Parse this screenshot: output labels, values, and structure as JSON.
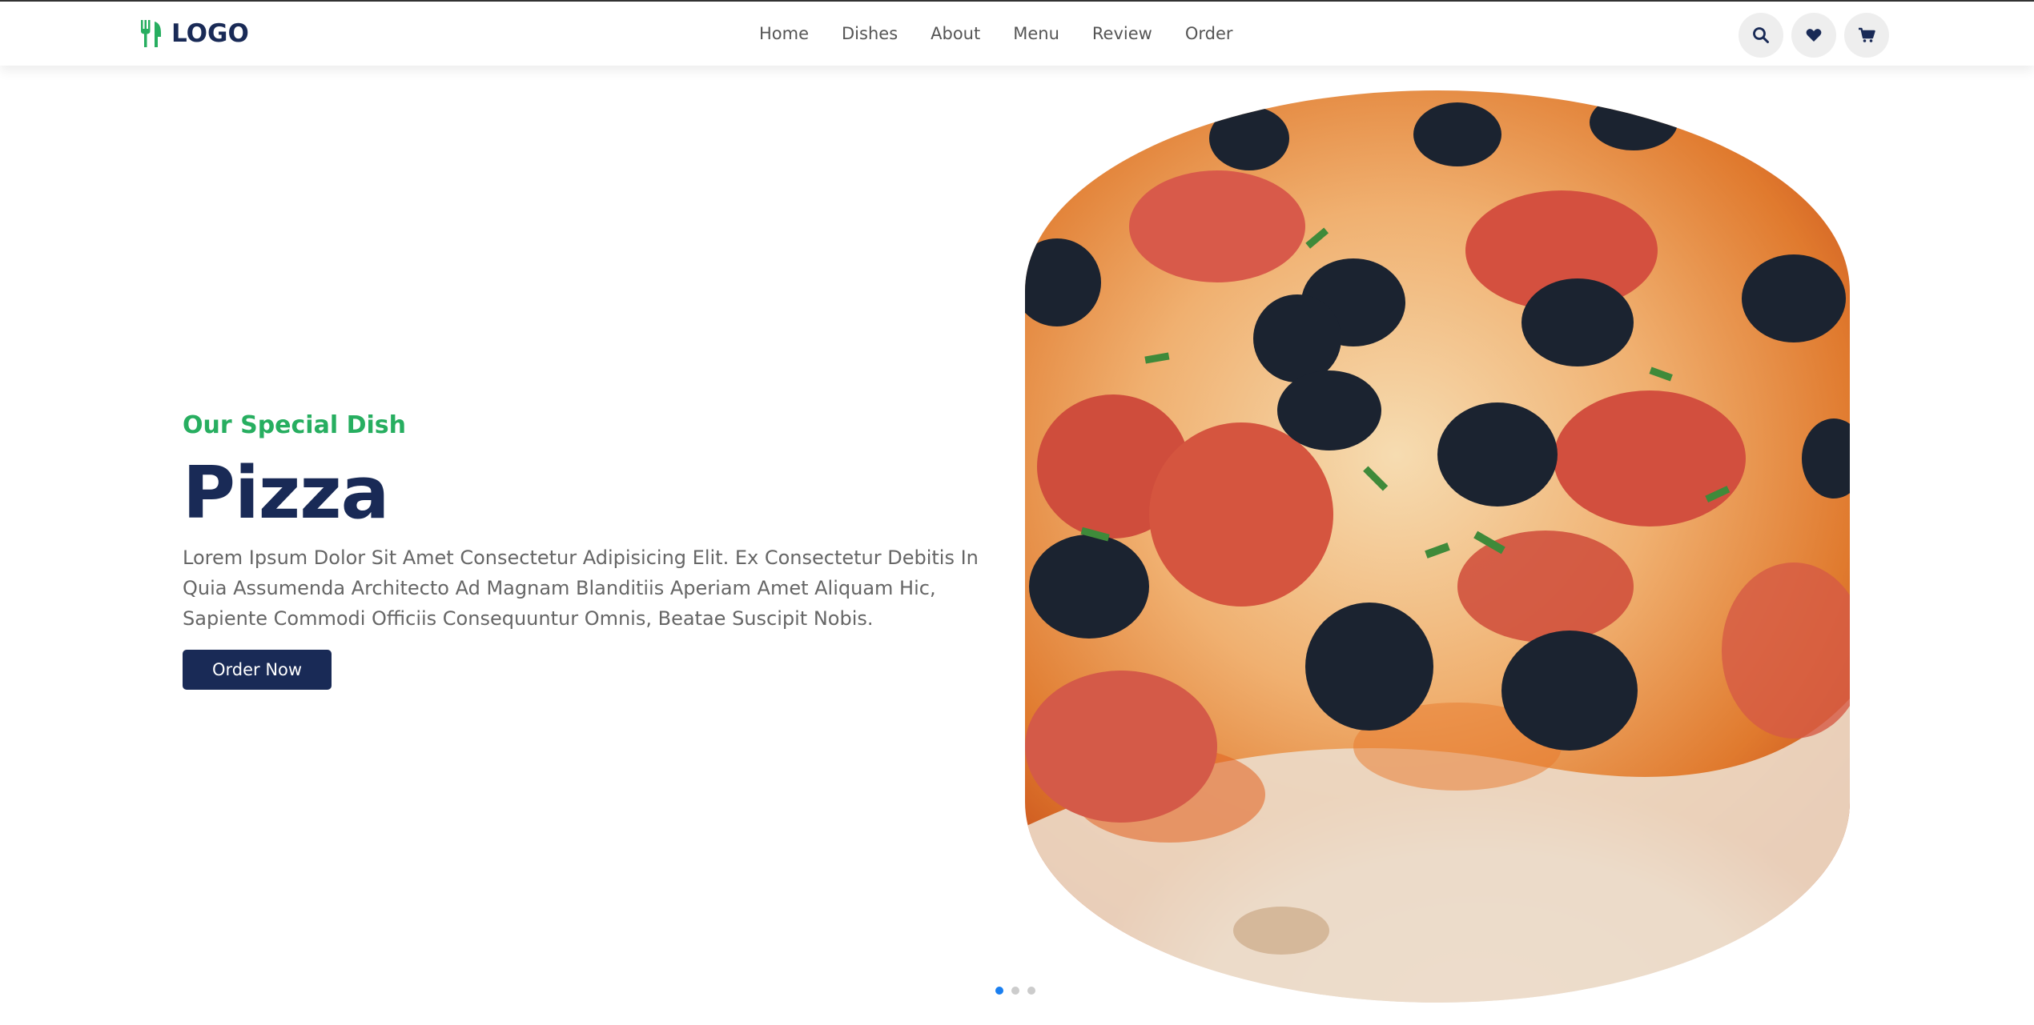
{
  "header": {
    "logo_text": "LOGO",
    "nav": [
      "Home",
      "Dishes",
      "About",
      "Menu",
      "Review",
      "Order"
    ],
    "icons": [
      "search-icon",
      "heart-icon",
      "cart-icon"
    ]
  },
  "hero": {
    "subtitle": "Our Special Dish",
    "title": "Pizza",
    "description": "Lorem Ipsum Dolor Sit Amet Consectetur Adipisicing Elit. Ex Consectetur Debitis In Quia Assumenda Architecto Ad Magnam Blanditiis Aperiam Amet Aliquam Hic, Sapiente Commodi Officiis Consequuntur Omnis, Beatae Suscipit Nobis.",
    "button": "Order Now"
  },
  "slider": {
    "slides": 3,
    "active": 1
  },
  "colors": {
    "accent": "#27ae60",
    "navy": "#192a56",
    "dot_active": "#1a7ff0"
  }
}
